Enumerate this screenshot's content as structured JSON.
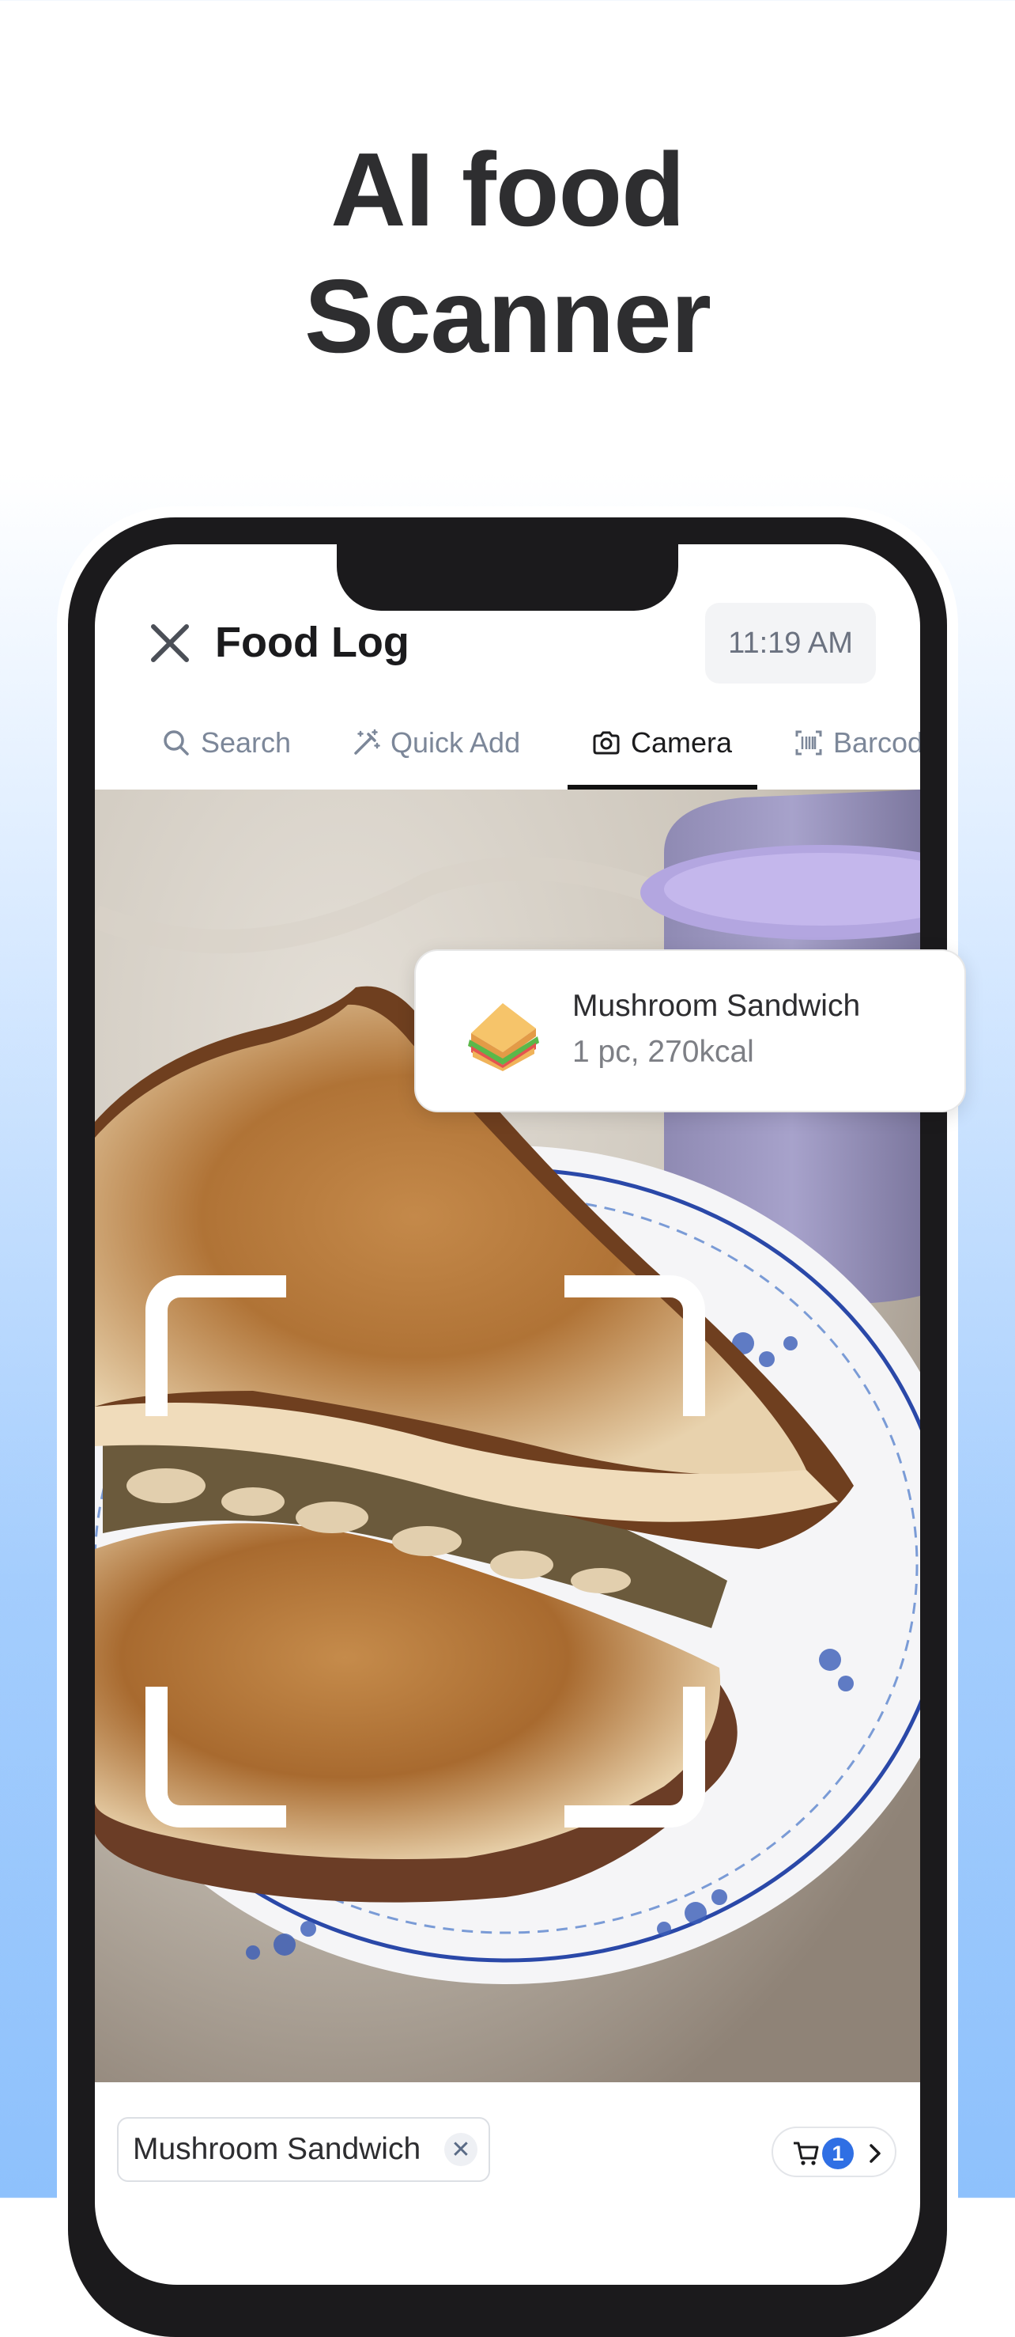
{
  "headline": {
    "line1": "AI food",
    "line2": "Scanner"
  },
  "header": {
    "title": "Food Log",
    "time": "11:19 AM",
    "close_icon": "close-icon"
  },
  "tabs": [
    {
      "label": "Search",
      "icon": "search-icon",
      "active": false
    },
    {
      "label": "Quick Add",
      "icon": "magic-wand-icon",
      "active": false
    },
    {
      "label": "Camera",
      "icon": "camera-icon",
      "active": true
    },
    {
      "label": "Barcode",
      "icon": "barcode-icon",
      "active": false
    }
  ],
  "scan_result": {
    "name": "Mushroom Sandwich",
    "meta": "1 pc, 270kcal",
    "icon": "sandwich-icon"
  },
  "bottom": {
    "chip_label": "Mushroom Sandwich",
    "cart_count": "1"
  },
  "colors": {
    "accent": "#2f6fe4",
    "tab_active": "#111111",
    "tab_inactive": "#7c8799"
  }
}
